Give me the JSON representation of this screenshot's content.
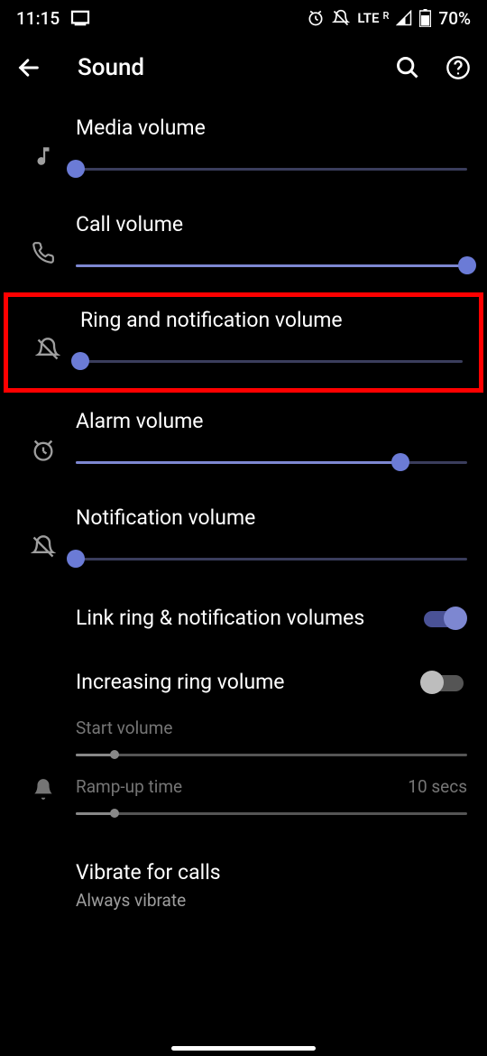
{
  "status": {
    "time": "11:15",
    "network": "LTE",
    "roaming": "R",
    "battery": "70%"
  },
  "header": {
    "title": "Sound"
  },
  "sliders": {
    "media": {
      "label": "Media volume",
      "value": 0
    },
    "call": {
      "label": "Call volume",
      "value": 100
    },
    "ring": {
      "label": "Ring and notification volume",
      "value": 0
    },
    "alarm": {
      "label": "Alarm volume",
      "value": 83
    },
    "notification": {
      "label": "Notification volume",
      "value": 0
    }
  },
  "toggles": {
    "link": {
      "label": "Link ring & notification volumes",
      "on": true
    },
    "increasing": {
      "label": "Increasing ring volume",
      "on": false
    }
  },
  "increasing_sub": {
    "start": {
      "label": "Start volume",
      "value": 10
    },
    "ramp": {
      "label": "Ramp-up time",
      "value_label": "10 secs",
      "value": 10
    }
  },
  "vibrate": {
    "title": "Vibrate for calls",
    "subtitle": "Always vibrate"
  }
}
